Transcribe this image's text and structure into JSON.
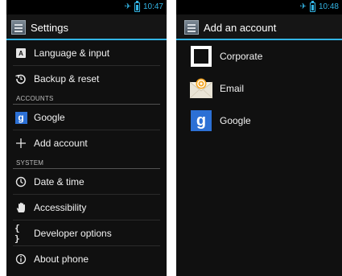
{
  "left": {
    "status": {
      "time": "10:47"
    },
    "title": "Settings",
    "items": [
      {
        "label": "Language & input"
      },
      {
        "label": "Backup & reset"
      },
      {
        "section": "ACCOUNTS"
      },
      {
        "label": "Google"
      },
      {
        "label": "Add account"
      },
      {
        "section": "SYSTEM"
      },
      {
        "label": "Date & time"
      },
      {
        "label": "Accessibility"
      },
      {
        "label": "Developer options"
      },
      {
        "label": "About phone"
      }
    ],
    "lang_icon_letter": "A",
    "google_icon_letter": "g"
  },
  "right": {
    "status": {
      "time": "10:48"
    },
    "title": "Add an account",
    "accounts": [
      {
        "label": "Corporate",
        "icon": "corporate-icon"
      },
      {
        "label": "Email",
        "icon": "email-icon"
      },
      {
        "label": "Google",
        "icon": "google-icon"
      }
    ],
    "google_icon_letter": "g"
  },
  "colors": {
    "accent": "#33b5e5",
    "background": "#101010",
    "google": "#2c70d5"
  }
}
